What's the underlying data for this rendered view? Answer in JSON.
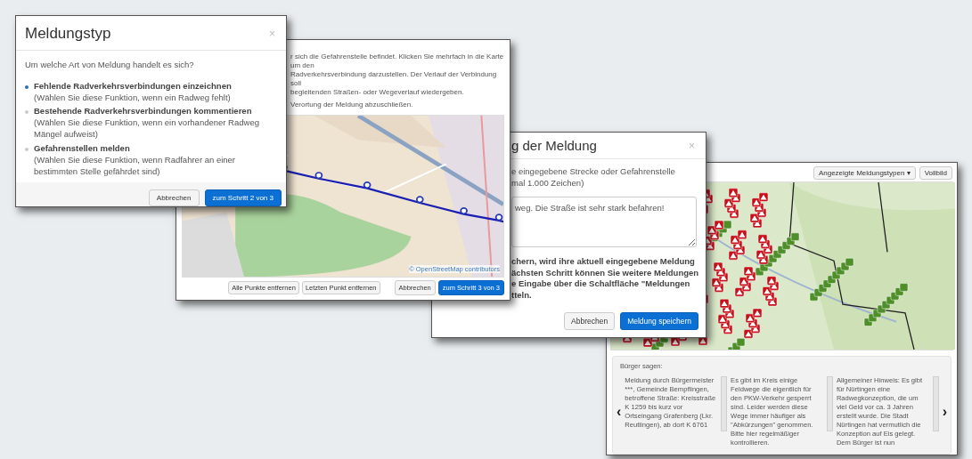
{
  "type_dialog": {
    "title": "Meldungstyp",
    "close": "×",
    "question": "Um welche Art von Meldung handelt es sich?",
    "options": [
      {
        "label": "Fehlende Radverkehrsverbindungen einzeichnen",
        "hint": "(Wählen Sie diese Funktion, wenn ein Radweg fehlt)",
        "selected": true
      },
      {
        "label": "Bestehende Radverkehrsverbindungen kommentieren",
        "hint": "(Wählen Sie diese Funktion, wenn ein vorhandener Radweg Mängel aufweist)",
        "selected": false
      },
      {
        "label": "Gefahrenstellen melden",
        "hint": "(Wählen Sie diese Funktion, wenn Radfahrer an einer bestimmten Stelle gefährdet sind)",
        "selected": false
      }
    ],
    "buttons": [
      {
        "label": "Abbrechen",
        "kind": "default"
      },
      {
        "label": "zum Schritt 2 von 3",
        "kind": "primary"
      }
    ]
  },
  "route_dialog": {
    "text_lines": [
      "r sich die Gefahrenstelle befindet. Klicken Sie mehrfach in die Karte um den",
      "Radverkehrsverbindung darzustellen. Der Verlauf der Verbindung soll",
      "begleitenden Straßen- oder Wegeverlauf wiedergeben.",
      "Verortung der Meldung abzuschließen."
    ],
    "map_attribution": "© OpenStreetMap contributors",
    "tool_buttons": [
      "Alle Punkte entfernen",
      "Letzten Punkt entfernen"
    ],
    "buttons": [
      {
        "label": "Abbrechen",
        "kind": "default"
      },
      {
        "label": "zum Schritt 3 von 3",
        "kind": "primary"
      }
    ]
  },
  "description_dialog": {
    "title": "g der Meldung",
    "close": "×",
    "prompt_lines": [
      "e eingegebene Strecke oder Gefahrenstelle",
      "mal 1.000 Zeichen)"
    ],
    "textarea_value": "weg. Die Straße ist sehr stark befahren!",
    "note_lines": [
      "chern, wird ihre aktuell eingegebene Meldung",
      "ächsten Schritt können Sie weitere Meldungen",
      "e Eingabe über die Schaltfläche \"Meldungen",
      "tteln."
    ],
    "buttons": [
      {
        "label": "Abbrechen",
        "kind": "default"
      },
      {
        "label": "Meldung speichern",
        "kind": "primary"
      }
    ]
  },
  "overview_window": {
    "toolbar": [
      {
        "label": "Angezeigte Meldungstypen",
        "caret": "▾"
      },
      {
        "label": "Vollbild"
      }
    ],
    "comments_heading": "Bürger sagen:",
    "prev": "‹",
    "next": "›",
    "comments": [
      "Meldung durch Bürgermeister ***, Gemeinde Bempflingen, betroffene Straße: Kreisstraße K 1259 bis kurz vor Ortseingang Grafenberg (Lkr. Reutlingen), ab dort K 6761",
      "Es gibt im Kreis einige Feldwege die eigentlich für den PKW-Verkehr gesperrt sind. Leider werden diese Wege immer häufiger als \"Abkürzungen\" genommen. Bitte hier regelmäßiger kontrollieren.",
      "Allgemeiner Hinweis: Es gibt für Nürtingen eine Radwegkonzeption, die um viel Geld vor ca. 3 Jahren erstellt wurde. Die Stadt Nürtingen hat vermutlich die Konzeption auf Eis gelegt. Dem Bürger ist nun"
    ]
  }
}
